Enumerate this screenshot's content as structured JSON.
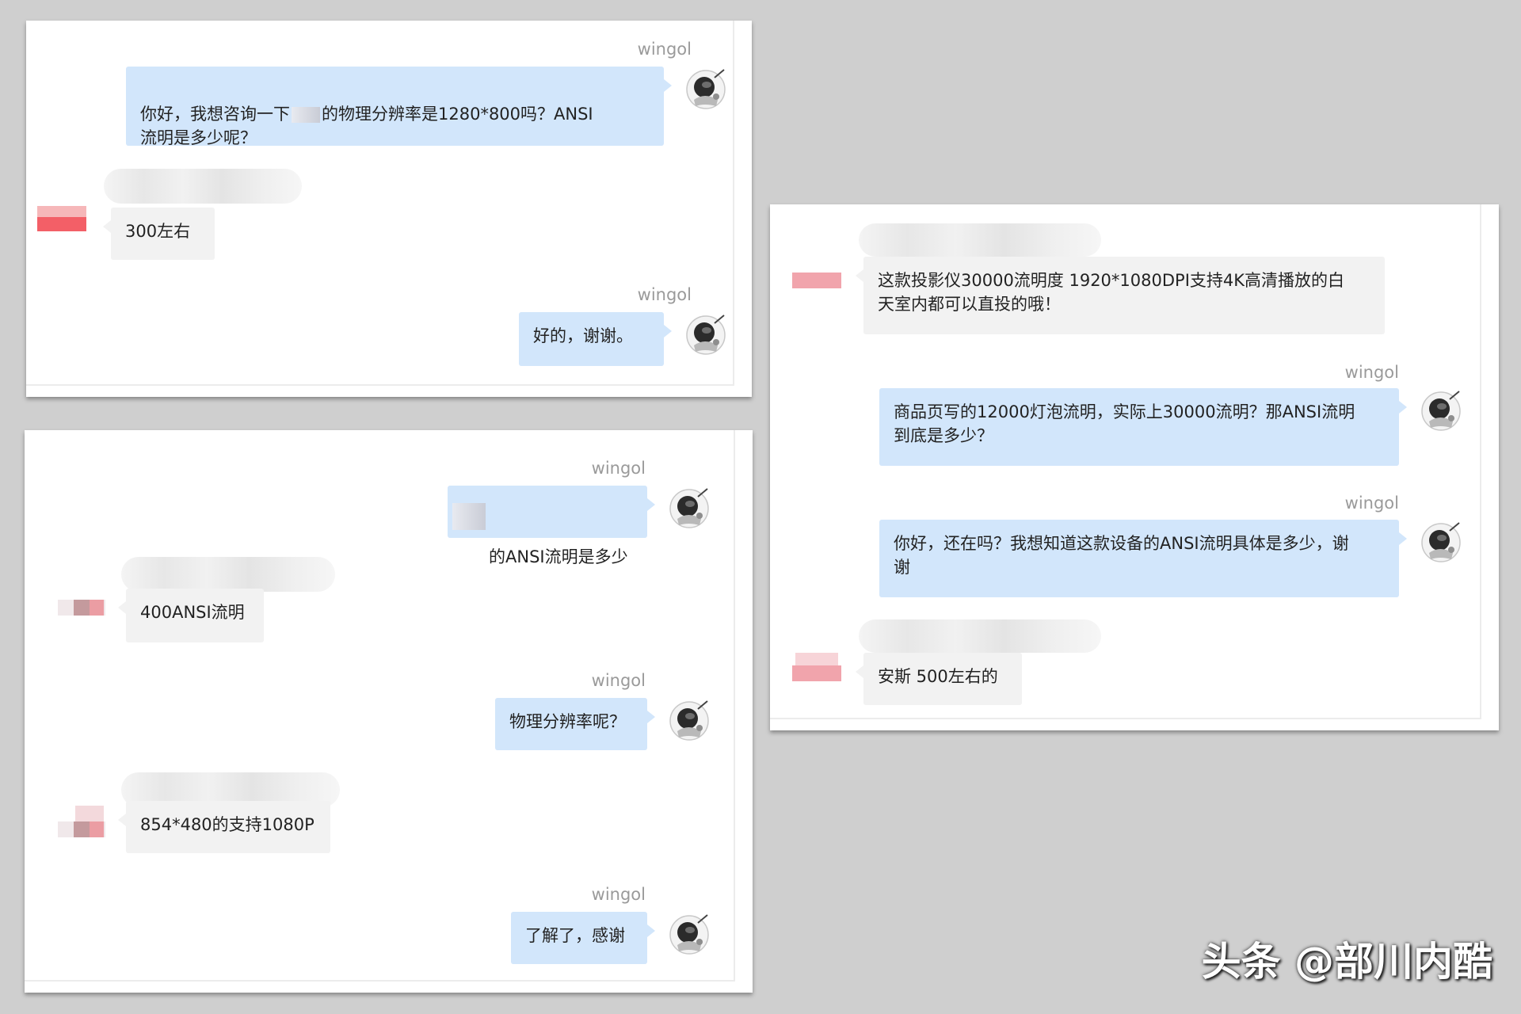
{
  "sender_name": "wingol",
  "colors": {
    "my_bubble": "#d2e6fb",
    "their_bubble": "#f2f2f2",
    "background": "#cfcfcf"
  },
  "icons": {
    "my_avatar": "astronaut-avatar-icon",
    "their_avatar": "blurred-avatar"
  },
  "panel_top_left": {
    "messages": [
      {
        "from": "me",
        "name": "wingol",
        "text_before": "你好，我想咨询一下",
        "text_after": "的物理分辨率是1280*800吗？ANSI\n流明是多少呢？"
      },
      {
        "from": "them",
        "text": "300左右"
      },
      {
        "from": "me",
        "name": "wingol",
        "text": "好的，谢谢。"
      }
    ]
  },
  "panel_bottom_left": {
    "messages": [
      {
        "from": "me",
        "name": "wingol",
        "text": "的ANSI流明是多少"
      },
      {
        "from": "them",
        "text": "400ANSI流明"
      },
      {
        "from": "me",
        "name": "wingol",
        "text": "物理分辨率呢？"
      },
      {
        "from": "them",
        "text": "854*480的支持1080P"
      },
      {
        "from": "me",
        "name": "wingol",
        "text": "了解了，感谢"
      }
    ]
  },
  "panel_right": {
    "messages": [
      {
        "from": "them",
        "text": "这款投影仪30000流明度 1920*1080DPI支持4K高清播放的白\n天室内都可以直投的哦！"
      },
      {
        "from": "me",
        "name": "wingol",
        "text": "商品页写的12000灯泡流明，实际上30000流明？那ANSI流明\n到底是多少？"
      },
      {
        "from": "me",
        "name": "wingol",
        "text": "你好，还在吗？我想知道这款设备的ANSI流明具体是多少，谢\n谢"
      },
      {
        "from": "them",
        "text": "安斯 500左右的"
      }
    ]
  },
  "watermark": "头条 @部川内酷"
}
